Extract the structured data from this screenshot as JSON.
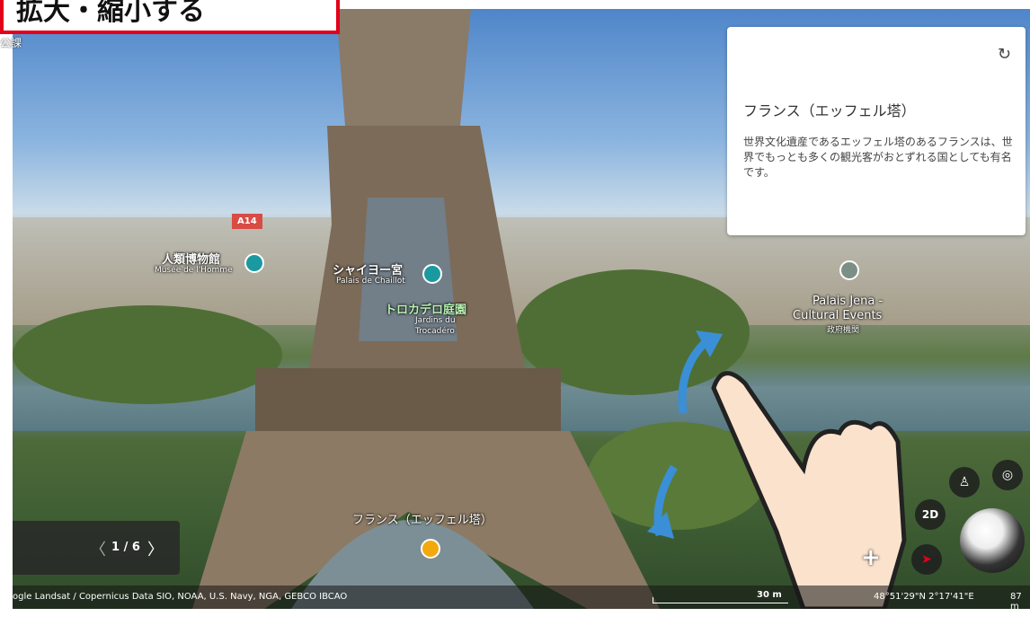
{
  "banner": {
    "text": "拡大・縮小する"
  },
  "top_left_text": "公課",
  "map": {
    "labels": {
      "a14": "A14",
      "musee_jp": "人類博物館",
      "musee_fr": "Musée de l'Homme",
      "chaillot_jp": "シャイヨー宮",
      "chaillot_fr": "Palais de Chaillot",
      "trocadero_jp": "トロカデロ庭園",
      "trocadero_fr1": "Jardins du",
      "trocadero_fr2": "Trocadéro",
      "jena1": "Palais Jena -",
      "jena2": "Cultural Events",
      "jena3": "政府機関",
      "place_label": "フランス（エッフェル塔）"
    }
  },
  "card": {
    "title": "フランス（エッフェル塔）",
    "description": "世界文化遺産であるエッフェル塔のあるフランスは、世界でもっとも多くの観光客がおとずれる国としても有名です。",
    "refresh_icon": "refresh-icon"
  },
  "nav": {
    "prev": "〈",
    "page": "1 / 6",
    "next": "〉"
  },
  "controls": {
    "mode_2d": "2D",
    "zoom_in": "+"
  },
  "footer": {
    "attribution": "ogle  Landsat / Copernicus  Data SIO, NOAA, U.S. Navy, NGA, GEBCO  IBCAO",
    "scale": "30 m",
    "coords": "48°51'29\"N 2°17'41\"E",
    "altitude": "87 m"
  },
  "colors": {
    "banner_border": "#e2001a",
    "arrow": "#3a8fd6",
    "pin_teal": "#1a9aa0",
    "pin_yellow": "#f3a90d"
  }
}
